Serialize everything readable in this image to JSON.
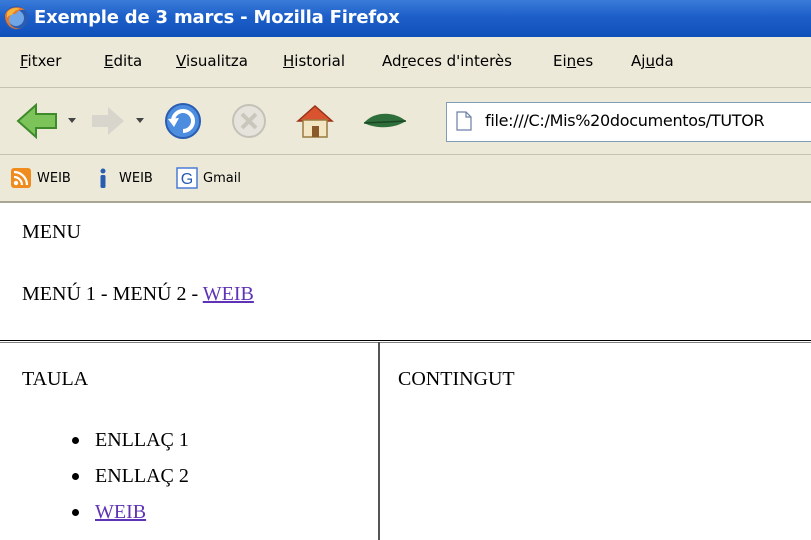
{
  "window": {
    "title": "Exemple de 3 marcs - Mozilla Firefox"
  },
  "menubar": {
    "items": [
      {
        "prefix": "",
        "accel": "F",
        "rest": "itxer"
      },
      {
        "prefix": "",
        "accel": "E",
        "rest": "dita"
      },
      {
        "prefix": "",
        "accel": "V",
        "rest": "isualitza"
      },
      {
        "prefix": "",
        "accel": "H",
        "rest": "istorial"
      },
      {
        "prefix": "Ad",
        "accel": "r",
        "rest": "eces d'interès"
      },
      {
        "prefix": "Ei",
        "accel": "n",
        "rest": "es"
      },
      {
        "prefix": "Aj",
        "accel": "u",
        "rest": "da"
      }
    ]
  },
  "toolbar": {
    "address": "file:///C:/Mis%20documentos/TUTOR"
  },
  "bookmarks": [
    {
      "label": "WEIB",
      "icon": "rss-feed-icon"
    },
    {
      "label": "WEIB",
      "icon": "info-icon"
    },
    {
      "label": "Gmail",
      "icon": "google-icon"
    }
  ],
  "top_frame": {
    "heading": "MENU",
    "menu1": "MENÚ 1",
    "separator": " - ",
    "menu2": "MENÚ 2",
    "link": "WEIB"
  },
  "left_frame": {
    "heading": "TAULA",
    "items": [
      "ENLLAÇ 1",
      "ENLLAÇ 2",
      "WEIB"
    ]
  },
  "right_frame": {
    "heading": "CONTINGUT"
  },
  "colors": {
    "titlebar": "#1d5fc9",
    "chrome": "#ece9d8",
    "link": "#5f33b5"
  }
}
